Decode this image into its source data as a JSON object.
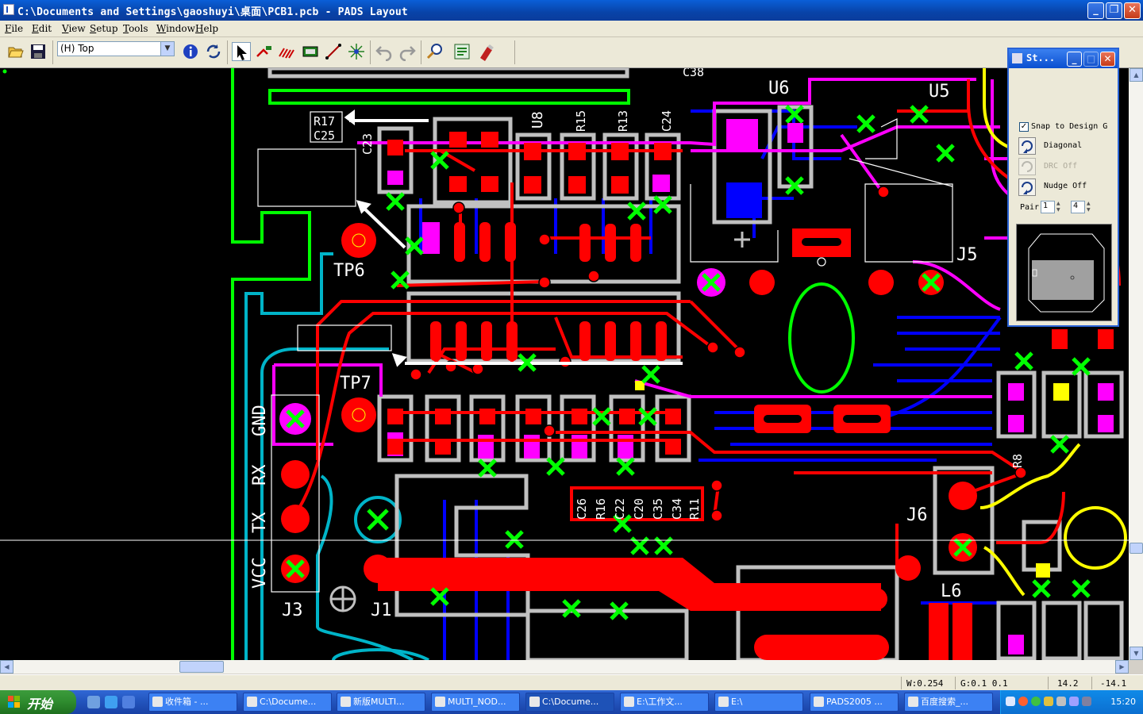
{
  "window": {
    "title": "C:\\Documents and Settings\\gaoshuyi\\桌面\\PCB1.pcb - PADS Layout"
  },
  "menu": [
    "File",
    "Edit",
    "View",
    "Setup",
    "Tools",
    "Window",
    "Help"
  ],
  "toolbar": {
    "layer_value": "(H) Top"
  },
  "panel": {
    "title": "St...",
    "snap_label": "Snap to Design G",
    "snap_checked": true,
    "diagonal_label": "Diagonal",
    "drc_label": "DRC Off",
    "nudge_label": "Nudge Off",
    "pair_label": "Pair",
    "pair_value_1": "1",
    "pair_value_2": "4"
  },
  "board_labels": {
    "r17": "R17",
    "c25": "C25",
    "c23": "C23",
    "u8": "U8",
    "r15": "R15",
    "r13": "R13",
    "c24": "C24",
    "c38": "C38",
    "u6": "U6",
    "u5": "U5",
    "j5": "J5",
    "tp6": "TP6",
    "tp7": "TP7",
    "gnd": "GND",
    "rx": "RX",
    "tx": "TX",
    "vcc": "VCC",
    "j3": "J3",
    "j1": "J1",
    "c26": "C26",
    "r16": "R16",
    "c22": "C22",
    "c20": "C20",
    "c35": "C35",
    "c34": "C34",
    "r11": "R11",
    "j6": "J6",
    "l6": "L6",
    "r8": "R8"
  },
  "status": {
    "width": "W:0.254",
    "grid": "G:0.1 0.1",
    "x": "14.2",
    "y": "-14.1"
  },
  "taskbar": {
    "start": "开始",
    "tasks": [
      "收件箱 - ...",
      "C:\\Docume...",
      "新版MULTI...",
      "MULTI_NOD...",
      "C:\\Docume...",
      "E:\\工作文...",
      "E:\\",
      "PADS2005 ...",
      "百度搜索_..."
    ],
    "clock": "15:20"
  },
  "colors": {
    "top_copper": "#ff0000",
    "bottom_copper": "#0000ff",
    "silkscreen": "#ffffff",
    "outline_green": "#00ff00",
    "magenta": "#ff00ff",
    "cyan": "#00b4c8",
    "pad_gray": "#c0c0c0",
    "yellow": "#ffff00"
  }
}
